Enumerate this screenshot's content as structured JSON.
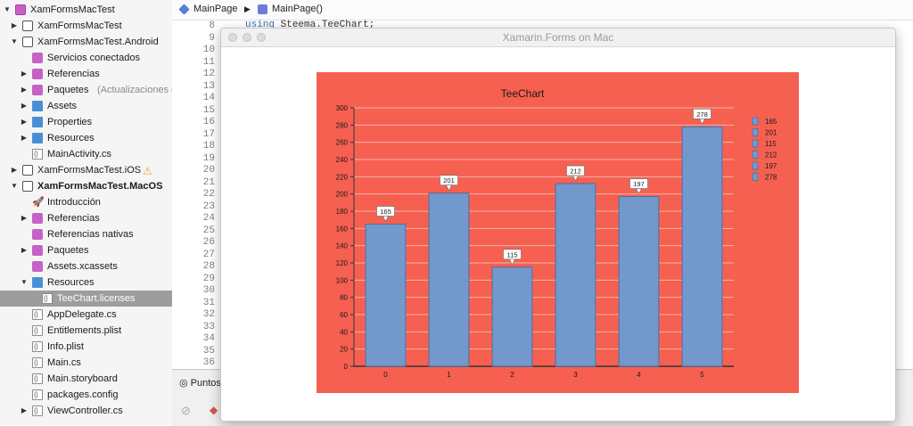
{
  "sidebar": {
    "items": [
      {
        "label": "XamFormsMacTest",
        "depth": 0,
        "disclosure": "open",
        "icon": "solution-icon",
        "bold": false
      },
      {
        "label": "XamFormsMacTest",
        "depth": 1,
        "disclosure": "closed",
        "icon": "project-icon"
      },
      {
        "label": "XamFormsMacTest.Android",
        "depth": 1,
        "disclosure": "open",
        "icon": "project-icon"
      },
      {
        "label": "Servicios conectados",
        "depth": 2,
        "disclosure": "none",
        "icon": "connected-services-icon"
      },
      {
        "label": "Referencias",
        "depth": 2,
        "disclosure": "closed",
        "icon": "references-icon"
      },
      {
        "label": "Paquetes",
        "sub": "(Actualizaciones de 1)",
        "depth": 2,
        "disclosure": "closed",
        "icon": "packages-icon"
      },
      {
        "label": "Assets",
        "depth": 2,
        "disclosure": "closed",
        "icon": "folder-icon"
      },
      {
        "label": "Properties",
        "depth": 2,
        "disclosure": "closed",
        "icon": "folder-icon"
      },
      {
        "label": "Resources",
        "depth": 2,
        "disclosure": "closed",
        "icon": "folder-icon"
      },
      {
        "label": "MainActivity.cs",
        "depth": 2,
        "disclosure": "none",
        "icon": "csharp-file-icon"
      },
      {
        "label": "XamFormsMacTest.iOS",
        "depth": 1,
        "disclosure": "closed",
        "icon": "project-icon",
        "warning": true
      },
      {
        "label": "XamFormsMacTest.MacOS",
        "depth": 1,
        "disclosure": "open",
        "icon": "project-icon",
        "bold": true
      },
      {
        "label": "Introducción",
        "depth": 2,
        "disclosure": "none",
        "icon": "rocket-icon"
      },
      {
        "label": "Referencias",
        "depth": 2,
        "disclosure": "closed",
        "icon": "references-icon"
      },
      {
        "label": "Referencias nativas",
        "depth": 2,
        "disclosure": "none",
        "icon": "native-references-icon"
      },
      {
        "label": "Paquetes",
        "depth": 2,
        "disclosure": "closed",
        "icon": "packages-icon"
      },
      {
        "label": "Assets.xcassets",
        "depth": 2,
        "disclosure": "none",
        "icon": "assets-icon"
      },
      {
        "label": "Resources",
        "depth": 2,
        "disclosure": "open",
        "icon": "folder-icon"
      },
      {
        "label": "TeeChart.licenses",
        "depth": 3,
        "disclosure": "none",
        "icon": "file-icon",
        "selected": true
      },
      {
        "label": "AppDelegate.cs",
        "depth": 2,
        "disclosure": "none",
        "icon": "csharp-file-icon"
      },
      {
        "label": "Entitlements.plist",
        "depth": 2,
        "disclosure": "none",
        "icon": "plist-file-icon"
      },
      {
        "label": "Info.plist",
        "depth": 2,
        "disclosure": "none",
        "icon": "plist-file-icon"
      },
      {
        "label": "Main.cs",
        "depth": 2,
        "disclosure": "none",
        "icon": "csharp-file-icon"
      },
      {
        "label": "Main.storyboard",
        "depth": 2,
        "disclosure": "none",
        "icon": "storyboard-file-icon"
      },
      {
        "label": "packages.config",
        "depth": 2,
        "disclosure": "none",
        "icon": "config-file-icon"
      },
      {
        "label": "ViewController.cs",
        "depth": 2,
        "disclosure": "closed",
        "icon": "csharp-file-icon"
      }
    ]
  },
  "editor": {
    "breadcrumb": [
      {
        "label": "MainPage",
        "icon": "class-icon"
      },
      {
        "label": "MainPage()",
        "icon": "method-icon"
      }
    ],
    "line_numbers": [
      "8",
      "9",
      "10",
      "11",
      "12",
      "13",
      "14",
      "15",
      "16",
      "17",
      "18",
      "19",
      "20",
      "21",
      "22",
      "23",
      "24",
      "25",
      "26",
      "27",
      "28",
      "29",
      "30",
      "31",
      "32",
      "33",
      "34",
      "35",
      "36"
    ],
    "code_line_8": {
      "keyword": "using",
      "rest": " Steema.TeeChart;"
    },
    "bottom_tab": "Puntos"
  },
  "window": {
    "title": "Xamarin.Forms on Mac"
  },
  "colors": {
    "chart_background": "#f66051",
    "bar_fill": "#7399cc",
    "bar_stroke": "#4a6fa5",
    "selected_row": "#9d9d9d"
  },
  "chart_data": {
    "type": "bar",
    "title": "TeeChart",
    "categories": [
      "0",
      "1",
      "2",
      "3",
      "4",
      "5"
    ],
    "values": [
      165,
      201,
      115,
      212,
      197,
      278
    ],
    "ylim": [
      0,
      300
    ],
    "yticks": [
      "0",
      "20",
      "40",
      "60",
      "80",
      "100",
      "120",
      "140",
      "160",
      "180",
      "200",
      "220",
      "240",
      "260",
      "280",
      "300"
    ],
    "grid": true,
    "legend": {
      "placement": "right",
      "entries": [
        "165",
        "201",
        "115",
        "212",
        "197",
        "278"
      ]
    },
    "data_labels": [
      "165",
      "201",
      "115",
      "212",
      "197",
      "278"
    ]
  }
}
